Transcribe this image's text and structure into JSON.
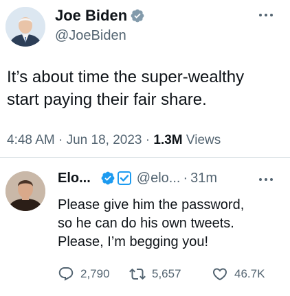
{
  "main_tweet": {
    "author_name": "Joe Biden",
    "author_handle": "@JoeBiden",
    "text_line1": "It’s about time the super-wealthy",
    "text_line2": "start paying their fair share.",
    "time": "4:48 AM",
    "sep1": " · ",
    "date": "Jun 18, 2023",
    "sep2": " · ",
    "views_count": "1.3M",
    "views_label": " Views",
    "icons": {
      "verified": "verified-badge-icon",
      "more": "more-dots-icon"
    }
  },
  "reply_tweet": {
    "author_name": "Elo...",
    "author_handle": "@elo...",
    "separator": "·",
    "time": "31m",
    "text_line1": "Please give him the password,",
    "text_line2": "so he can do his own tweets.",
    "text_line3": "Please, I’m begging you!",
    "stats": {
      "replies": "2,790",
      "retweets": "5,657",
      "likes": "46.7K"
    },
    "icons": {
      "verified": "verified-badge-icon",
      "affiliate": "affiliate-badge-icon",
      "reply": "reply-icon",
      "retweet": "retweet-icon",
      "like": "heart-icon",
      "more": "more-dots-icon"
    }
  },
  "colors": {
    "text_primary": "#0f1419",
    "text_secondary": "#536471",
    "verified_blue": "#1d9bf0",
    "divider": "#cfd9de"
  }
}
